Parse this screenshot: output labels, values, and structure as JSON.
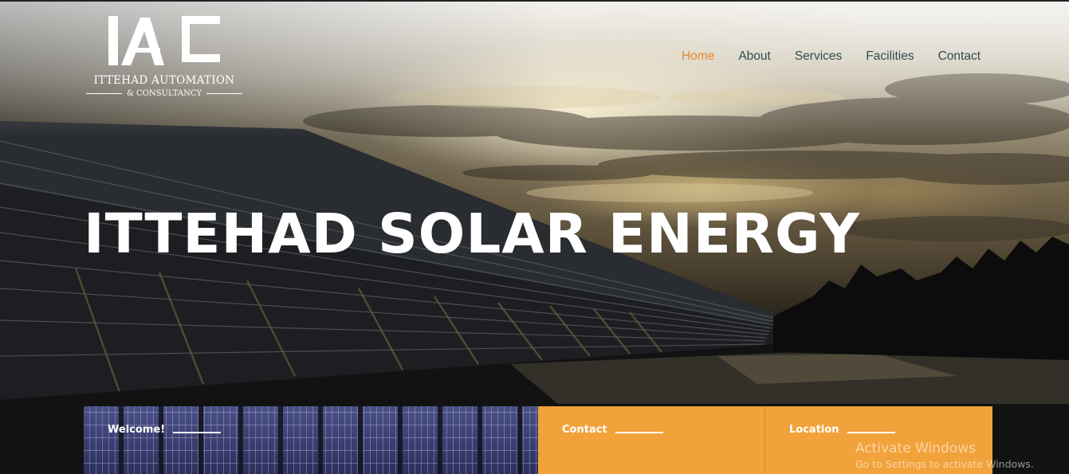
{
  "logo": {
    "mark": "IAC",
    "title": "ITTEHAD AUTOMATION",
    "subtitle": "& CONSULTANCY"
  },
  "nav": {
    "items": [
      {
        "label": "Home",
        "active": true
      },
      {
        "label": "About",
        "active": false
      },
      {
        "label": "Services",
        "active": false
      },
      {
        "label": "Facilities",
        "active": false
      },
      {
        "label": "Contact",
        "active": false
      }
    ],
    "active_color": "#e8862d",
    "color": "#2e4f4f"
  },
  "hero": {
    "title": "ITTEHAD SOLAR ENERGY"
  },
  "cards": [
    {
      "heading": "Welcome!"
    },
    {
      "heading": "Contact"
    },
    {
      "heading": "Location"
    }
  ],
  "watermark": {
    "title": "Activate Windows",
    "subtitle": "Go to Settings to activate Windows."
  },
  "colors": {
    "accent": "#f2a23a",
    "text_light": "#ffffff"
  }
}
